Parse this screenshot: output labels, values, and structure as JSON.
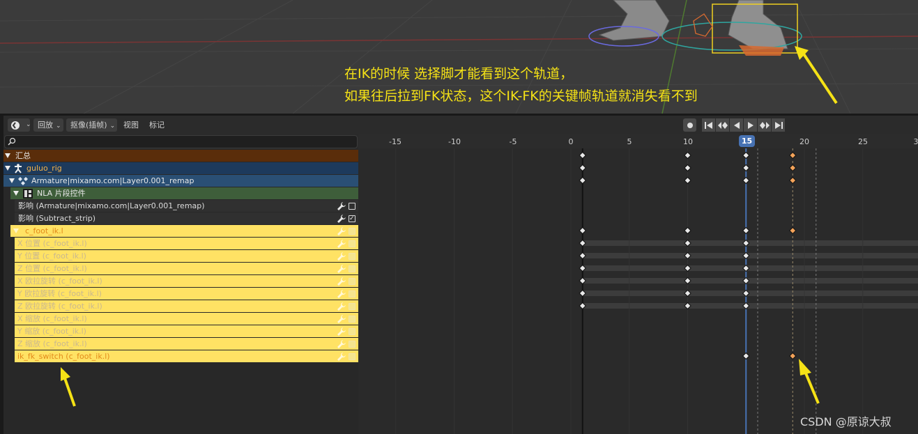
{
  "annotation": {
    "line1": "在IK的时候 选择脚才能看到这个轨道，",
    "line2": "如果往后拉到FK状态，这个IK-FK的关键帧轨道就消失看不到"
  },
  "header": {
    "editor_icon": "dope-sheet-icon",
    "playback": "回放",
    "keying": "抠像(插帧)",
    "view": "视图",
    "marker": "标记"
  },
  "ruler": {
    "ticks": [
      "-15",
      "-10",
      "-5",
      "0",
      "5",
      "10",
      "15",
      "20",
      "25",
      "3"
    ],
    "current_frame": "15"
  },
  "channels": [
    {
      "label": "汇总",
      "kind": "summary"
    },
    {
      "label": "guluo_rig",
      "kind": "object"
    },
    {
      "label": "Armature|mixamo.com|Layer0.001_remap",
      "kind": "action"
    },
    {
      "label": "NLA 片段控件",
      "kind": "nla"
    },
    {
      "label": "影响 (Armature|mixamo.com|Layer0.001_remap)",
      "kind": "plain",
      "checked": false
    },
    {
      "label": "影响 (Subtract_strip)",
      "kind": "plain",
      "checked": true
    },
    {
      "label": "c_foot_ik.l",
      "kind": "group"
    },
    {
      "label": "X 位置 (c_foot_ik.l)",
      "kind": "fcurve"
    },
    {
      "label": "Y 位置 (c_foot_ik.l)",
      "kind": "fcurve"
    },
    {
      "label": "Z 位置 (c_foot_ik.l)",
      "kind": "fcurve"
    },
    {
      "label": "X 欧拉旋转 (c_foot_ik.l)",
      "kind": "fcurve"
    },
    {
      "label": "Y 欧拉旋转 (c_foot_ik.l)",
      "kind": "fcurve"
    },
    {
      "label": "Z 欧拉旋转 (c_foot_ik.l)",
      "kind": "fcurve"
    },
    {
      "label": "X 缩放 (c_foot_ik.l)",
      "kind": "fcurve"
    },
    {
      "label": "Y 缩放 (c_foot_ik.l)",
      "kind": "fcurve"
    },
    {
      "label": "Z 缩放 (c_foot_ik.l)",
      "kind": "fcurve"
    },
    {
      "label": "ik_fk_switch (c_foot_ik.l)",
      "kind": "fcurve-highlight"
    }
  ],
  "keyframes": {
    "frames_main": [
      1,
      10,
      15
    ],
    "frame_switch": 19,
    "rows": [
      {
        "frames": [
          1,
          10,
          15,
          19
        ],
        "selected": [
          19
        ]
      },
      {
        "frames": [
          1,
          10,
          15,
          19
        ],
        "selected": [
          19
        ]
      },
      {
        "frames": [
          1,
          10,
          15,
          19
        ],
        "selected": [
          19
        ]
      },
      {
        "frames": [],
        "selected": []
      },
      {
        "frames": [],
        "selected": []
      },
      {
        "frames": [],
        "selected": []
      },
      {
        "frames": [
          1,
          10,
          15,
          19
        ],
        "selected": [
          19
        ]
      },
      {
        "frames": [
          1,
          10,
          15
        ],
        "selected": []
      },
      {
        "frames": [
          1,
          10,
          15
        ],
        "selected": []
      },
      {
        "frames": [
          1,
          10,
          15
        ],
        "selected": []
      },
      {
        "frames": [
          1,
          10,
          15
        ],
        "selected": []
      },
      {
        "frames": [
          1,
          10,
          15
        ],
        "selected": []
      },
      {
        "frames": [
          1,
          10,
          15
        ],
        "selected": []
      },
      {
        "frames": [],
        "selected": []
      },
      {
        "frames": [],
        "selected": []
      },
      {
        "frames": [],
        "selected": []
      },
      {
        "frames": [
          15,
          19
        ],
        "selected": [
          19
        ]
      }
    ]
  },
  "colors": {
    "summary_row": "#5a2d0a",
    "object_row": "#1d3a5c",
    "action_row": "#2a4f74",
    "nla_row": "#3e5e3a",
    "group_row": "#ffe264",
    "current_frame": "#4772b3",
    "annotation": "#f5e216",
    "selected_key": "#f3a35a"
  },
  "watermark": "CSDN @原谅大叔"
}
